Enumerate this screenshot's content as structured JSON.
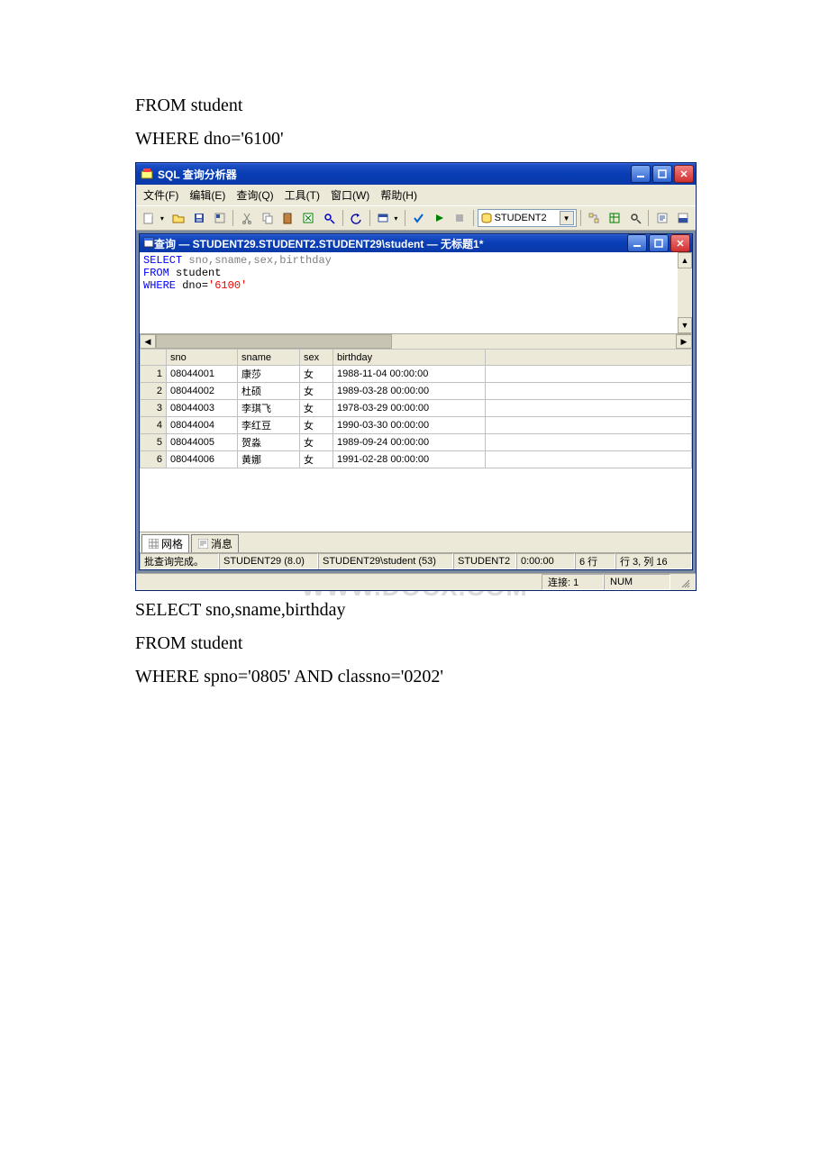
{
  "doc": {
    "line1": "FROM student",
    "line2": "WHERE dno='6100'",
    "line3": "SELECT sno,sname,birthday",
    "line4": "FROM student",
    "line5": "WHERE spno='0805' AND classno='0202'"
  },
  "app": {
    "title": "SQL 查询分析器",
    "menus": {
      "file": "文件(F)",
      "edit": "编辑(E)",
      "query": "查询(Q)",
      "tools": "工具(T)",
      "window": "窗口(W)",
      "help": "帮助(H)"
    },
    "db_combo": "STUDENT2"
  },
  "query_window": {
    "title": "查询 — STUDENT29.STUDENT2.STUDENT29\\student — 无标题1*",
    "sql_blue1": "SELECT",
    "sql_rest1": " sno,sname,sex,birthday",
    "sql_blue2": "FROM",
    "sql_rest2": " student",
    "sql_blue3": "WHERE",
    "sql_rest3": " dno=",
    "sql_red3": "'6100'"
  },
  "grid": {
    "headers": {
      "sno": "sno",
      "sname": "sname",
      "sex": "sex",
      "birthday": "birthday"
    },
    "rows": [
      {
        "n": "1",
        "sno": "08044001",
        "sname": "康莎",
        "sex": "女",
        "birthday": "1988-11-04 00:00:00"
      },
      {
        "n": "2",
        "sno": "08044002",
        "sname": "杜硕",
        "sex": "女",
        "birthday": "1989-03-28 00:00:00"
      },
      {
        "n": "3",
        "sno": "08044003",
        "sname": "李琪飞",
        "sex": "女",
        "birthday": "1978-03-29 00:00:00"
      },
      {
        "n": "4",
        "sno": "08044004",
        "sname": "李红豆",
        "sex": "女",
        "birthday": "1990-03-30 00:00:00"
      },
      {
        "n": "5",
        "sno": "08044005",
        "sname": "贺淼",
        "sex": "女",
        "birthday": "1989-09-24 00:00:00"
      },
      {
        "n": "6",
        "sno": "08044006",
        "sname": "黄娜",
        "sex": "女",
        "birthday": "1991-02-28 00:00:00"
      }
    ]
  },
  "tabs": {
    "grid": "网格",
    "messages": "消息"
  },
  "status1": {
    "main": "批查询完成。",
    "ver": "STUDENT29 (8.0)",
    "usr": "STUDENT29\\student (53)",
    "db": "STUDENT2",
    "time": "0:00:00",
    "rows": "6 行",
    "pos": "行 3, 列 16"
  },
  "status2": {
    "conn": "连接: 1",
    "num": "NUM"
  },
  "watermark": "WWW.DOCX.COM"
}
